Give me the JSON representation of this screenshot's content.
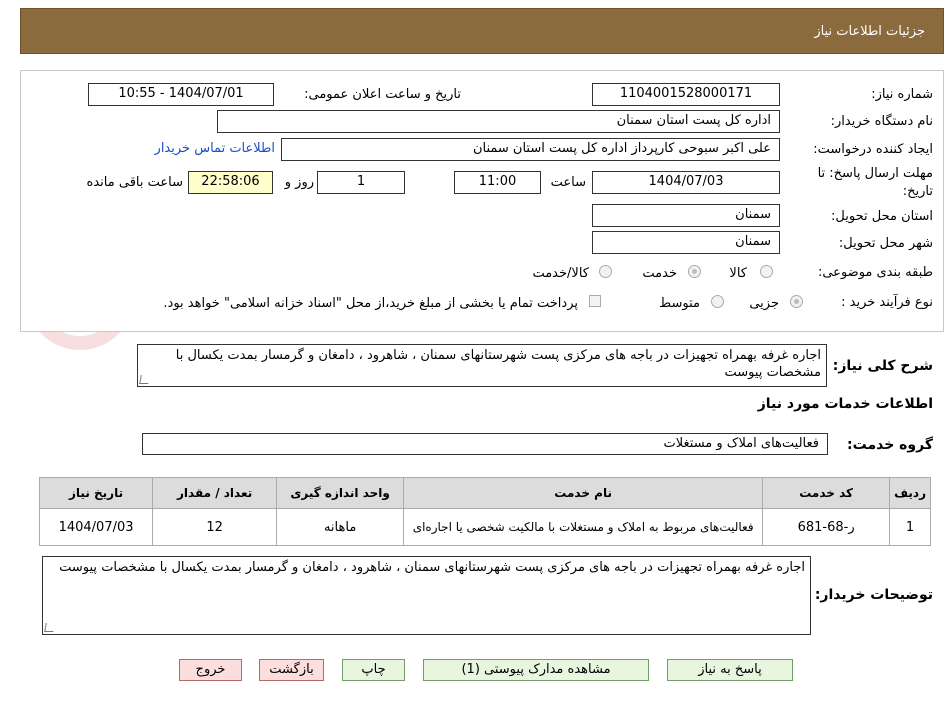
{
  "header": {
    "title": "جزئیات اطلاعات نیاز"
  },
  "form": {
    "need_number_label": "شماره نیاز:",
    "need_number": "1104001528000171",
    "announce_label": "تاریخ و ساعت اعلان عمومی:",
    "announce_value": "1404/07/01 - 10:55",
    "buyer_org_label": "نام دستگاه خریدار:",
    "buyer_org": "اداره کل پست استان سمنان",
    "creator_label": "ایجاد کننده درخواست:",
    "creator": "علی اکبر سبوحی کارپرداز اداره کل پست استان سمنان",
    "contact_link": "اطلاعات تماس خریدار",
    "deadline_label": "مهلت ارسال پاسخ: تا تاریخ:",
    "deadline_date": "1404/07/03",
    "time_label": "ساعت",
    "deadline_time": "11:00",
    "days_value": "1",
    "days_label": "روز و",
    "remaining_time": "22:58:06",
    "remaining_label": "ساعت باقی مانده",
    "province_label": "استان محل تحویل:",
    "province": "سمنان",
    "city_label": "شهر محل تحویل:",
    "city": "سمنان",
    "category_label": "طبقه بندی موضوعی:",
    "category_options": [
      "کالا",
      "خدمت",
      "کالا/خدمت"
    ],
    "process_label": "نوع فرآیند خرید :",
    "process_options": [
      "جزیی",
      "متوسط"
    ],
    "payment_note": "پرداخت تمام یا بخشی از مبلغ خرید،از محل \"اسناد خزانه اسلامی\" خواهد بود."
  },
  "summary": {
    "label": "شرح کلی نیاز:",
    "text": "اجاره غرفه بهمراه تجهیزات در باجه های مرکزی پست شهرستانهای سمنان ، شاهرود ، دامغان و گرمسار بمدت یکسال با مشخصات پیوست"
  },
  "services": {
    "section_title": "اطلاعات خدمات مورد نیاز",
    "group_label": "گروه خدمت:",
    "group_value": "فعالیت‌های  املاک و مستغلات",
    "columns": [
      "ردیف",
      "کد خدمت",
      "نام خدمت",
      "واحد اندازه گیری",
      "تعداد / مقدار",
      "تاریخ نیاز"
    ],
    "rows": [
      [
        "1",
        "ر-68-681",
        "فعالیت‌های مربوط به املاک و مستغلات با مالکیت شخصی یا اجاره‌ای",
        "ماهانه",
        "12",
        "1404/07/03"
      ]
    ]
  },
  "buyer_notes": {
    "label": "توضیحات خریدار:",
    "text": "اجاره غرفه بهمراه تجهیزات در باجه های مرکزی پست شهرستانهای سمنان ، شاهرود ، دامغان و گرمسار  بمدت یکسال با مشخصات پیوست"
  },
  "buttons": {
    "reply": "پاسخ به نیاز",
    "attachments": "مشاهده مدارک پیوستی (1)",
    "print": "چاپ",
    "back": "بازگشت",
    "exit": "خروج"
  },
  "colors": {
    "title_bar": "#8b6a3e",
    "button_green": "#e8f6e0",
    "button_red": "#fddede",
    "table_header": "#dcdcdc"
  }
}
